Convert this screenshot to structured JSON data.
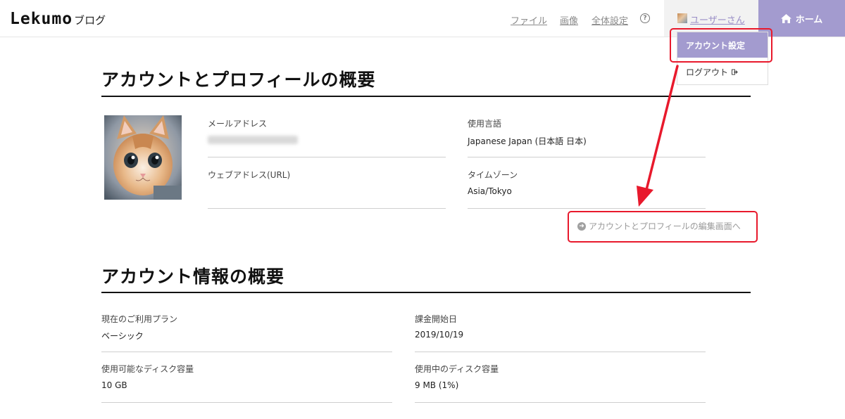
{
  "header": {
    "logo_main": "Lekumo",
    "logo_sub": "ブログ",
    "nav": [
      "ファイル",
      "画像",
      "全体設定"
    ],
    "help_symbol": "?",
    "user_name": "ユーザーさん",
    "home_label": "ホーム",
    "home_icon": "home-icon",
    "accent_color": "#a39bcf"
  },
  "dropdown": {
    "account_settings": "アカウント設定",
    "logout": "ログアウト",
    "logout_icon": "logout-icon"
  },
  "profile_section": {
    "title": "アカウントとプロフィールの概要",
    "email_label": "メールアドレス",
    "url_label": "ウェブアドレス(URL)",
    "url_value": "",
    "language_label": "使用言語",
    "language_value": "Japanese Japan (日本語 日本)",
    "timezone_label": "タイムゾーン",
    "timezone_value": "Asia/Tokyo",
    "edit_link": "アカウントとプロフィールの編集画面へ",
    "edit_icon": "circle-arrow-right-icon"
  },
  "account_section": {
    "title": "アカウント情報の概要",
    "plan_label": "現在のご利用プラン",
    "plan_value": "ベーシック",
    "billing_label": "課金開始日",
    "billing_value": "2019/10/19",
    "disk_available_label": "使用可能なディスク容量",
    "disk_available_value": "10 GB",
    "disk_used_label": "使用中のディスク容量",
    "disk_used_value": "9 MB (1%)"
  },
  "annotation_color": "#e8192c"
}
